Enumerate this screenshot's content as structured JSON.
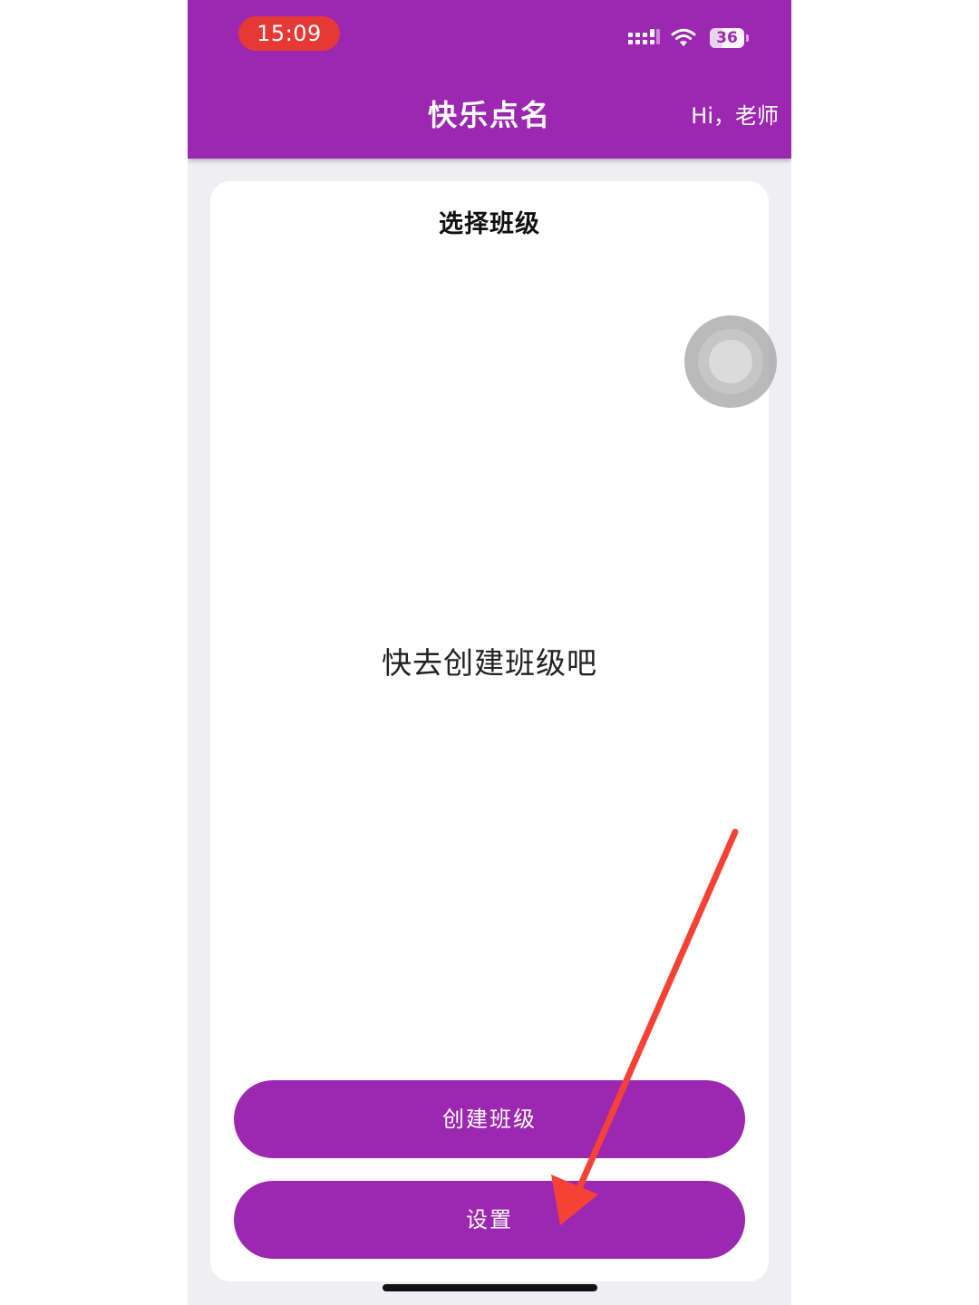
{
  "status_bar": {
    "time": "15:09",
    "battery_level": "36",
    "icons": [
      "signal-icon",
      "wifi-icon",
      "battery-icon"
    ]
  },
  "app_bar": {
    "title": "快乐点名",
    "greeting": "Hi，老师"
  },
  "main": {
    "card_title": "选择班级",
    "empty_message": "快去创建班级吧"
  },
  "actions": {
    "create_class_label": "创建班级",
    "settings_label": "设置"
  },
  "colors": {
    "primary": "#9c27b0",
    "time_pill": "#e53935",
    "background": "#efeef3",
    "card": "#ffffff",
    "annotation_arrow": "#f44336"
  }
}
